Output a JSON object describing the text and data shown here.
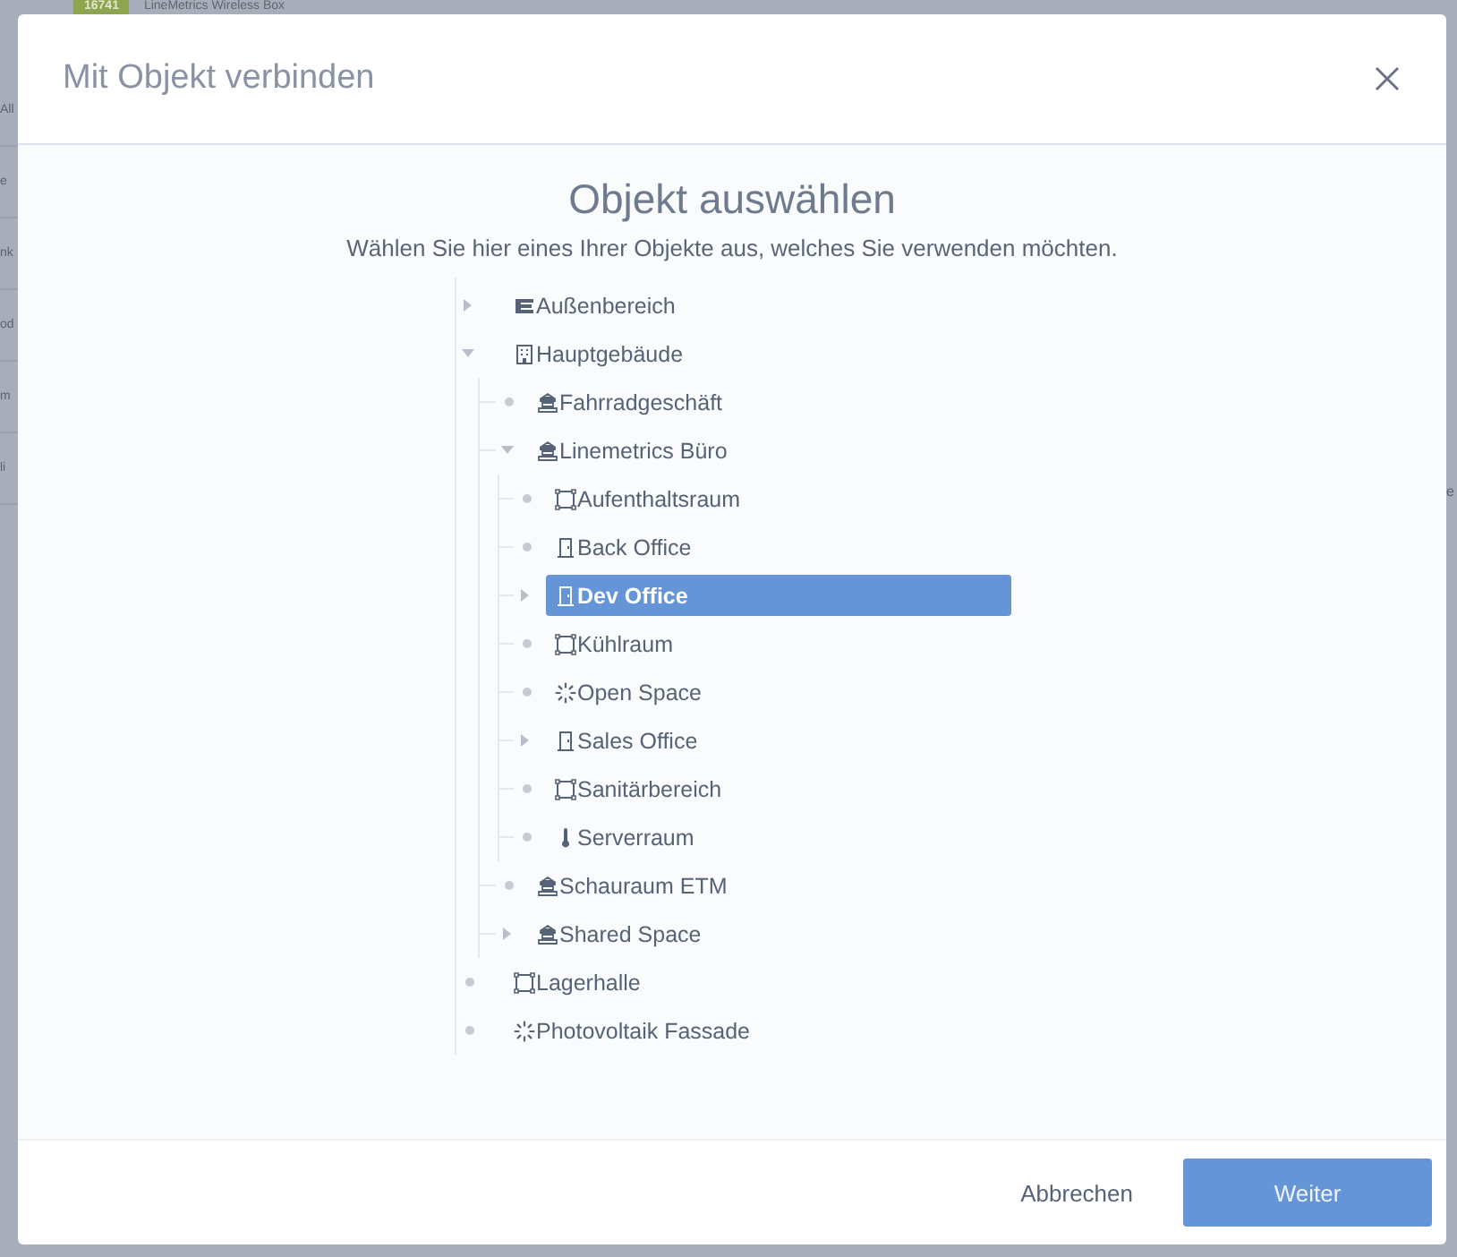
{
  "background": {
    "badge": "16741",
    "title": "LineMetrics Wireless Box",
    "side_items": [
      "All",
      "e",
      "nk",
      "od",
      "m",
      "li"
    ],
    "right_item": "e"
  },
  "dialog": {
    "title": "Mit Objekt verbinden",
    "heading": "Objekt auswählen",
    "description": "Wählen Sie hier eines Ihrer Objekte aus, welches Sie verwenden möchten.",
    "tree": [
      {
        "label": "Außenbereich",
        "kind": "zone",
        "expandable": true,
        "expanded": false,
        "selected": false
      },
      {
        "label": "Hauptgebäude",
        "kind": "building",
        "expandable": true,
        "expanded": true,
        "selected": false,
        "children": [
          {
            "label": "Fahrradgeschäft",
            "kind": "site",
            "expandable": false,
            "selected": false
          },
          {
            "label": "Linemetrics Büro",
            "kind": "site",
            "expandable": true,
            "expanded": true,
            "selected": false,
            "children": [
              {
                "label": "Aufenthaltsraum",
                "kind": "area",
                "expandable": false,
                "selected": false
              },
              {
                "label": "Back Office",
                "kind": "door",
                "expandable": false,
                "selected": false
              },
              {
                "label": "Dev Office",
                "kind": "door",
                "expandable": true,
                "expanded": false,
                "selected": true
              },
              {
                "label": "Kühlraum",
                "kind": "area",
                "expandable": false,
                "selected": false
              },
              {
                "label": "Open Space",
                "kind": "solar",
                "expandable": false,
                "selected": false
              },
              {
                "label": "Sales Office",
                "kind": "door",
                "expandable": true,
                "expanded": false,
                "selected": false
              },
              {
                "label": "Sanitärbereich",
                "kind": "area",
                "expandable": false,
                "selected": false
              },
              {
                "label": "Serverraum",
                "kind": "sensor",
                "expandable": false,
                "selected": false
              }
            ]
          },
          {
            "label": "Schauraum ETM",
            "kind": "site",
            "expandable": false,
            "selected": false
          },
          {
            "label": "Shared Space",
            "kind": "site",
            "expandable": true,
            "expanded": false,
            "selected": false
          }
        ]
      },
      {
        "label": "Lagerhalle",
        "kind": "area",
        "expandable": false,
        "selected": false
      },
      {
        "label": "Photovoltaik Fassade",
        "kind": "solar",
        "expandable": false,
        "selected": false
      }
    ],
    "buttons": {
      "cancel": "Abbrechen",
      "confirm": "Weiter"
    }
  }
}
